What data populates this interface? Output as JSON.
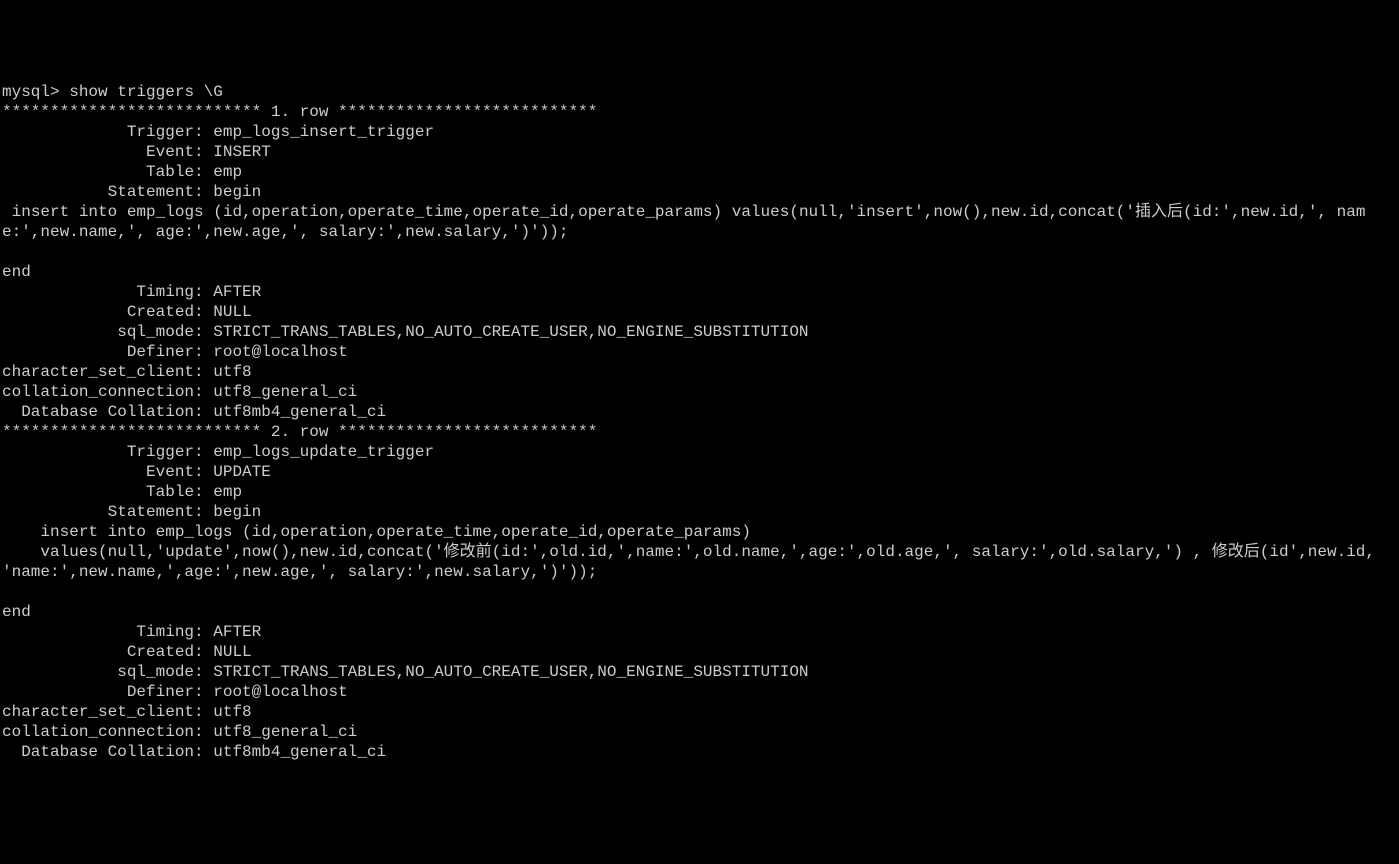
{
  "terminal": {
    "prompt": "mysql> ",
    "command": "show triggers \\G",
    "row_separator_1": "*************************** 1. row ***************************",
    "row_separator_2": "*************************** 2. row ***************************",
    "row1": {
      "trigger_label": "             Trigger: ",
      "trigger_value": "emp_logs_insert_trigger",
      "event_label": "               Event: ",
      "event_value": "INSERT",
      "table_label": "               Table: ",
      "table_value": "emp",
      "statement_label": "           Statement: ",
      "statement_value": "begin",
      "statement_body": " insert into emp_logs (id,operation,operate_time,operate_id,operate_params) values(null,'insert',now(),new.id,concat('插入后(id:',new.id,', name:',new.name,', age:',new.age,', salary:',new.salary,')'));",
      "end": "end",
      "timing_label": "              Timing: ",
      "timing_value": "AFTER",
      "created_label": "             Created: ",
      "created_value": "NULL",
      "sql_mode_label": "            sql_mode: ",
      "sql_mode_value": "STRICT_TRANS_TABLES,NO_AUTO_CREATE_USER,NO_ENGINE_SUBSTITUTION",
      "definer_label": "             Definer: ",
      "definer_value": "root@localhost",
      "charset_label": "character_set_client: ",
      "charset_value": "utf8",
      "collation_conn_label": "collation_connection: ",
      "collation_conn_value": "utf8_general_ci",
      "db_collation_label": "  Database Collation: ",
      "db_collation_value": "utf8mb4_general_ci"
    },
    "row2": {
      "trigger_label": "             Trigger: ",
      "trigger_value": "emp_logs_update_trigger",
      "event_label": "               Event: ",
      "event_value": "UPDATE",
      "table_label": "               Table: ",
      "table_value": "emp",
      "statement_label": "           Statement: ",
      "statement_value": "begin",
      "statement_body": "    insert into emp_logs (id,operation,operate_time,operate_id,operate_params)\n    values(null,'update',now(),new.id,concat('修改前(id:',old.id,',name:',old.name,',age:',old.age,', salary:',old.salary,') , 修改后(id',new.id, 'name:',new.name,',age:',new.age,', salary:',new.salary,')'));",
      "end": "end",
      "timing_label": "              Timing: ",
      "timing_value": "AFTER",
      "created_label": "             Created: ",
      "created_value": "NULL",
      "sql_mode_label": "            sql_mode: ",
      "sql_mode_value": "STRICT_TRANS_TABLES,NO_AUTO_CREATE_USER,NO_ENGINE_SUBSTITUTION",
      "definer_label": "             Definer: ",
      "definer_value": "root@localhost",
      "charset_label": "character_set_client: ",
      "charset_value": "utf8",
      "collation_conn_label": "collation_connection: ",
      "collation_conn_value": "utf8_general_ci",
      "db_collation_label": "  Database Collation: ",
      "db_collation_value": "utf8mb4_general_ci"
    }
  }
}
